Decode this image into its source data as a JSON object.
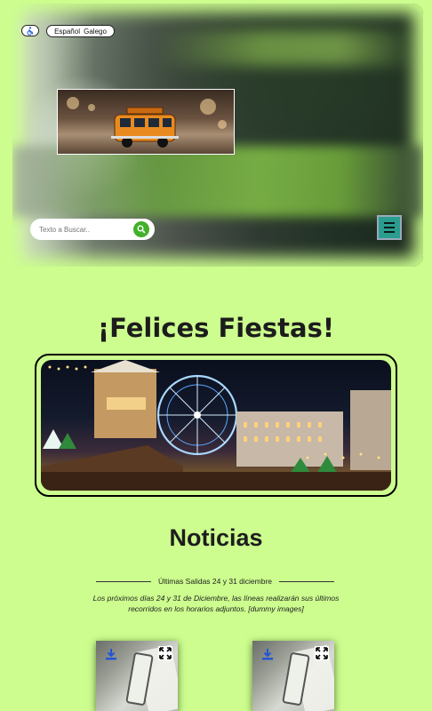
{
  "header": {
    "accessibility_icon": "wheelchair-icon",
    "languages": [
      "Español",
      "Galego"
    ]
  },
  "search": {
    "placeholder": "Texto a Buscar..",
    "icon": "search-icon"
  },
  "menu": {
    "icon": "hamburger-icon"
  },
  "hero_title": "¡Felices Fiestas!",
  "news": {
    "section_title": "Noticias",
    "item_title": "Últimas Salidas 24 y 31 diciembre",
    "item_body": "Los próximos días 24 y 31 de Diciembre, las líneas realizarán sus últimos recorridos en los horarios adjuntos. [dummy images]"
  },
  "colors": {
    "page_background": "#ccfd8e",
    "search_button": "#43b02a",
    "menu_button": "#2a9d8f"
  }
}
